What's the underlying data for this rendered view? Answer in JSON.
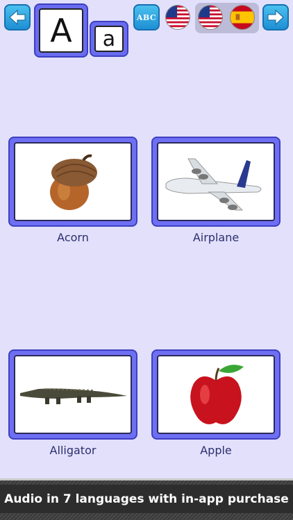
{
  "header": {
    "prev_icon": "arrow-left-icon",
    "next_icon": "arrow-right-icon",
    "uppercase_letter": "A",
    "lowercase_letter": "a",
    "abc_label": "ABC",
    "flags": [
      "us-flag-icon",
      "us-flag-icon",
      "spain-flag-icon"
    ]
  },
  "cards": [
    {
      "label": "Acorn",
      "image": "acorn-image"
    },
    {
      "label": "Airplane",
      "image": "airplane-image"
    },
    {
      "label": "Alligator",
      "image": "alligator-image"
    },
    {
      "label": "Apple",
      "image": "apple-image"
    }
  ],
  "banner": {
    "text": "Audio in 7 languages with in-app purchase"
  },
  "colors": {
    "background": "#e2e0fb",
    "card_frame": "#6e6ff2",
    "button_blue": "#1e8fd4",
    "label_text": "#2c2f6e"
  }
}
